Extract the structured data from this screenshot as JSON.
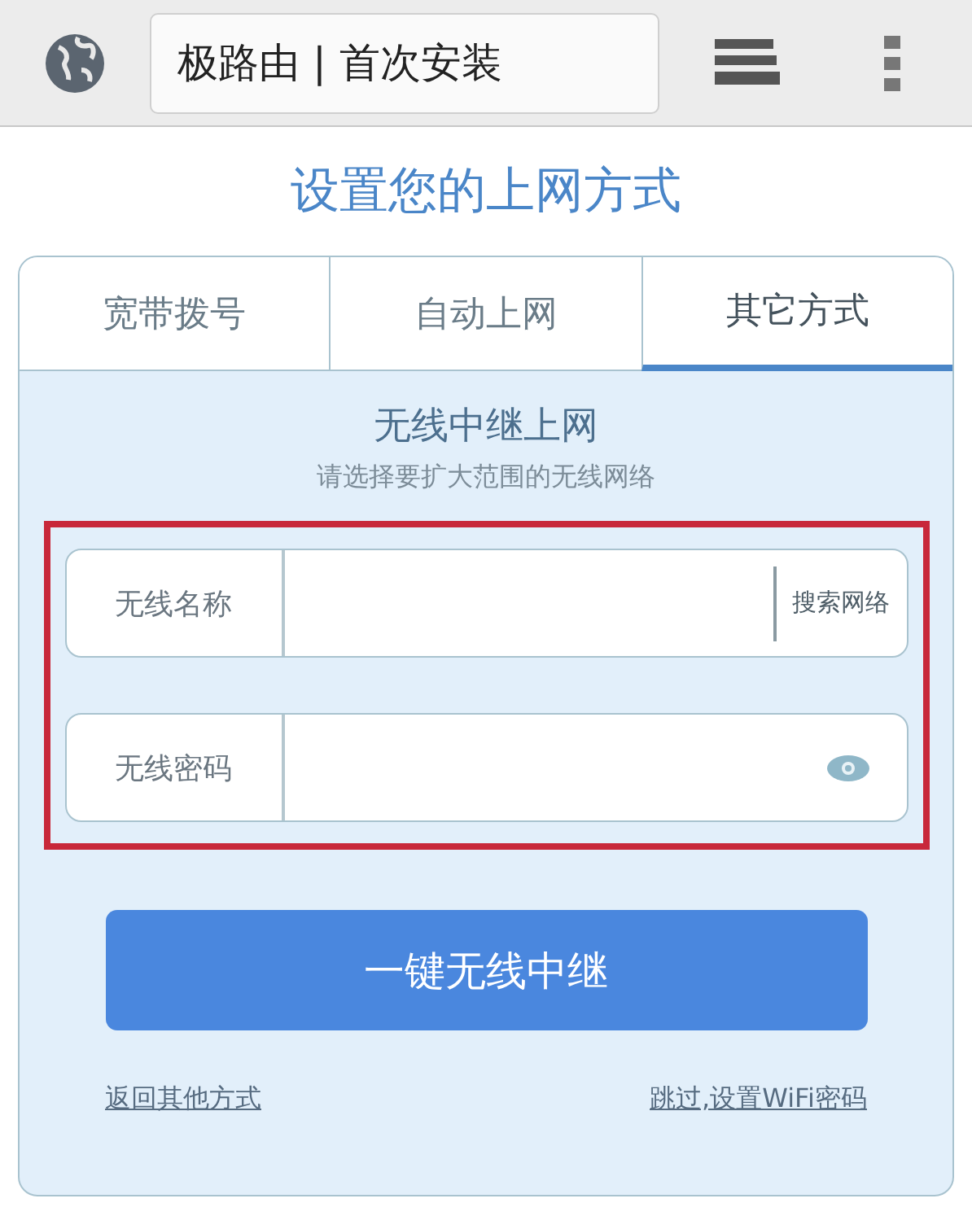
{
  "browser_bar": {
    "title": "极路由 | 首次安装"
  },
  "heading": "设置您的上网方式",
  "tabs": [
    {
      "label": "宽带拨号",
      "selected": false
    },
    {
      "label": "自动上网",
      "selected": false
    },
    {
      "label": "其它方式",
      "selected": true
    }
  ],
  "panel": {
    "title": "无线中继上网",
    "subtitle": "请选择要扩大范围的无线网络",
    "fields_highlighted": true,
    "fields": [
      {
        "label": "无线名称",
        "kind": "search",
        "action": "搜索网络"
      },
      {
        "label": "无线密码",
        "kind": "password"
      }
    ],
    "button": "一键无线中继",
    "links": [
      "返回其他方式",
      "跳过,设置WiFi密码"
    ]
  }
}
